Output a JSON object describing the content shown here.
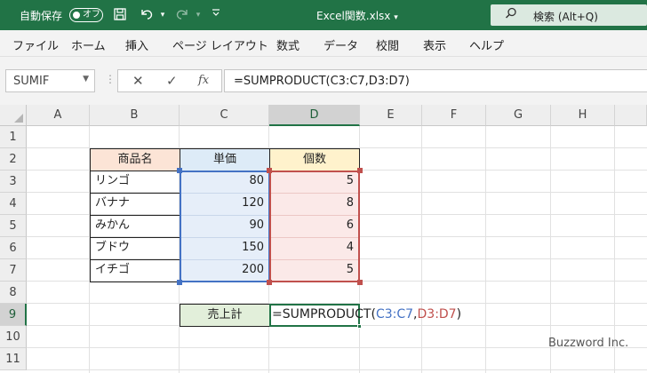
{
  "titlebar": {
    "autosave_label": "自動保存",
    "autosave_state": "オフ",
    "filename": "Excel関数.xlsx",
    "filename_arrow": "▾",
    "search_text": "検索 (Alt+Q)",
    "accent_color": "#217346"
  },
  "menu": {
    "items": [
      "ファイル",
      "ホーム",
      "挿入",
      "ページ レイアウト",
      "数式",
      "データ",
      "校閲",
      "表示",
      "ヘルプ"
    ]
  },
  "formula_bar": {
    "name_box": "SUMIF",
    "cancel_symbol": "✕",
    "enter_symbol": "✓",
    "fx_symbol": "fx",
    "formula": "=SUMPRODUCT(C3:C7,D3:D7)"
  },
  "sheet": {
    "columns": [
      "A",
      "B",
      "C",
      "D",
      "E",
      "F",
      "G",
      "H"
    ],
    "selected_column": "D",
    "rows": [
      "1",
      "2",
      "3",
      "4",
      "5",
      "6",
      "7",
      "8",
      "9",
      "10",
      "11"
    ],
    "selected_row": "9",
    "headers": {
      "name": "商品名",
      "price": "単価",
      "qty": "個数"
    },
    "products": [
      {
        "name": "リンゴ",
        "price": "80",
        "qty": "5"
      },
      {
        "name": "バナナ",
        "price": "120",
        "qty": "8"
      },
      {
        "name": "みかん",
        "price": "90",
        "qty": "6"
      },
      {
        "name": "ブドウ",
        "price": "150",
        "qty": "4"
      },
      {
        "name": "イチゴ",
        "price": "200",
        "qty": "5"
      }
    ],
    "total_label": "売上計",
    "edit_formula": {
      "prefix": "=SUMPRODUCT(",
      "ref1": "C3:C7",
      "comma": ",",
      "ref2": "D3:D7",
      "suffix": ")"
    },
    "colors": {
      "name_header_bg": "#fce4d6",
      "price_header_bg": "#ddebf7",
      "qty_header_bg": "#fff2cc",
      "total_label_bg": "#e2efda",
      "ref1_color": "#4472c4",
      "ref2_color": "#c0504d"
    }
  },
  "watermark": "Buzzword Inc."
}
